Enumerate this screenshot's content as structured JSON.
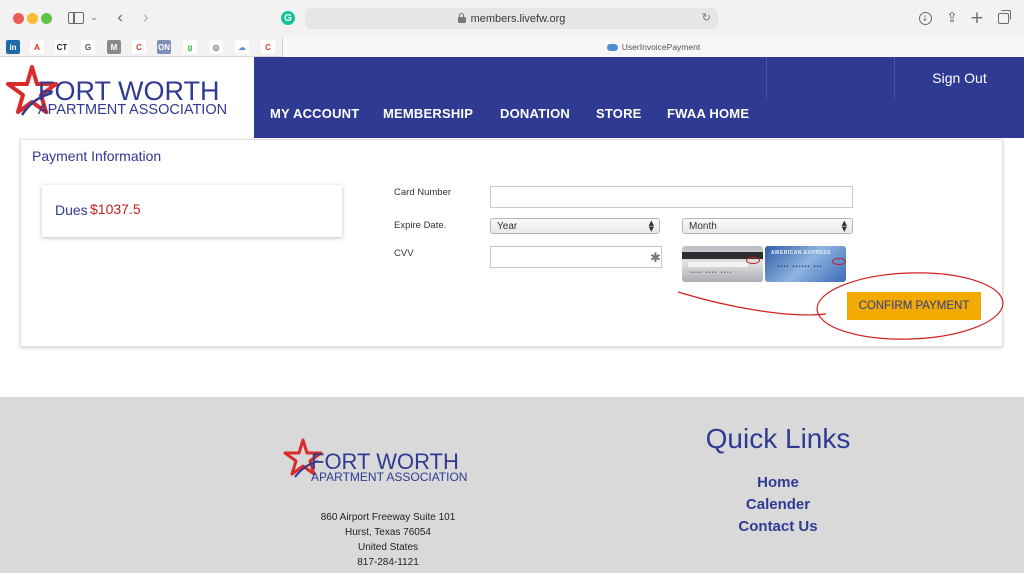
{
  "browser": {
    "url": "members.livefw.org",
    "tab_title": "UserInvoicePayment",
    "bookmarks": [
      {
        "label": "in",
        "icon": "linkedin-icon",
        "bg": "#1f6aa8",
        "fg": "#ffffff"
      },
      {
        "label": "A",
        "icon": "adobe-icon",
        "bg": "#ffffff",
        "fg": "#e3261a"
      },
      {
        "label": "CT",
        "icon": "ct-icon",
        "bg": "#ffffff",
        "fg": "#222222"
      },
      {
        "label": "G",
        "icon": "google-icon",
        "bg": "#ffffff",
        "fg": "#555555"
      },
      {
        "label": "M",
        "icon": "m-icon",
        "bg": "#8a8a8a",
        "fg": "#ffffff"
      },
      {
        "label": "C",
        "icon": "c-check-icon",
        "bg": "#ffffff",
        "fg": "#e03a2e"
      },
      {
        "label": "ON",
        "icon": "onenote-icon",
        "bg": "#7d8fb6",
        "fg": "#ffffff"
      },
      {
        "label": "g",
        "icon": "grammar-icon",
        "bg": "#ffffff",
        "fg": "#3cb14a"
      },
      {
        "label": "◎",
        "icon": "target-icon",
        "bg": "#ffffff",
        "fg": "#222222"
      },
      {
        "label": "☁",
        "icon": "cloud-icon",
        "bg": "#ffffff",
        "fg": "#4a8fd6"
      },
      {
        "label": "C",
        "icon": "c-check-icon-2",
        "bg": "#ffffff",
        "fg": "#e03a2e"
      }
    ]
  },
  "logo": {
    "line1": "FORT WORTH",
    "line2": "APARTMENT ASSOCIATION"
  },
  "header": {
    "sign_out": "Sign Out",
    "menu": [
      "MY ACCOUNT",
      "MEMBERSHIP",
      "DONATION",
      "STORE",
      "FWAA HOME"
    ]
  },
  "payment": {
    "title": "Payment Information",
    "dues_label": "Dues",
    "dues_amount": "$1037.5",
    "card_number_label": "Card Number",
    "card_number_value": "",
    "expire_label": "Expire Date.",
    "year_select": "Year",
    "month_select": "Month",
    "cvv_label": "CVV",
    "cvv_value": "",
    "confirm_label": "CONFIRM PAYMENT",
    "card_images": {
      "visa_dots": "•••• •••• ••••",
      "amex_name": "AMERICAN EXPRESS",
      "amex_num": "•••• •••••• •••"
    }
  },
  "footer": {
    "address": [
      "860 Airport Freeway Suite 101",
      "Hurst, Texas 76054",
      "United States",
      "817-284-1121"
    ],
    "quick_links_title": "Quick Links",
    "links": [
      "Home",
      "Calender",
      "Contact Us"
    ]
  },
  "colors": {
    "brand_blue": "#2f3a93",
    "accent_red": "#c31f1f",
    "button_gold": "#f2a900",
    "footer_grey": "#d9d9d9"
  }
}
